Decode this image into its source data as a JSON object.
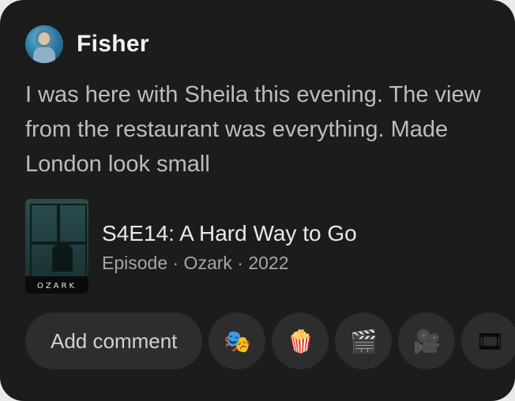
{
  "post": {
    "author": {
      "name": "Fisher"
    },
    "text": "I was here with Sheila this evening. The view from the restaurant was everything. Made London look small"
  },
  "media": {
    "poster_logo": "OZARK",
    "title": "S4E14: A Hard Way to Go",
    "subtitle": "Episode · Ozark · 2022"
  },
  "actions": {
    "add_comment_label": "Add comment",
    "reactions": [
      {
        "icon": "performing-arts-masks-icon",
        "glyph": "🎭"
      },
      {
        "icon": "popcorn-icon",
        "glyph": "🍿"
      },
      {
        "icon": "clapper-board-icon",
        "glyph": "🎬"
      },
      {
        "icon": "movie-camera-icon",
        "glyph": "🎥"
      },
      {
        "icon": "film-reel-icon",
        "glyph": "🎞"
      }
    ]
  },
  "colors": {
    "card_bg": "#1c1c1c",
    "chip_bg": "#2d2d2d",
    "text_primary": "#f3f3f3",
    "text_secondary": "#bdbdbd"
  }
}
